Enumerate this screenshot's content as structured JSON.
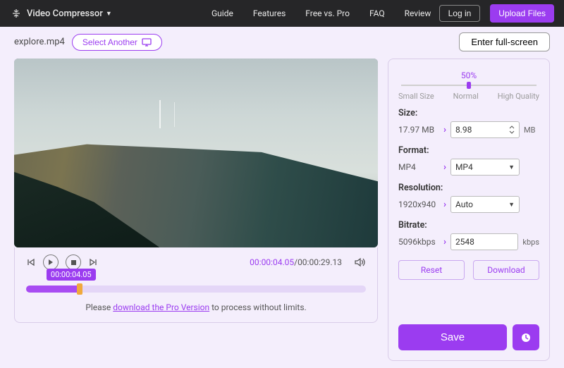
{
  "header": {
    "brand_icon": "compress-icon",
    "brand": "Video Compressor",
    "nav": [
      "Guide",
      "Features",
      "Free vs. Pro",
      "FAQ",
      "Review"
    ],
    "login": "Log in",
    "upload": "Upload Files"
  },
  "subheader": {
    "filename": "explore.mp4",
    "select_another": "Select Another",
    "fullscreen": "Enter full-screen"
  },
  "player": {
    "current_time": "00:00:04.05",
    "total_time": "00:00:29.13",
    "tooltip_time": "00:00:04.05",
    "progress_pct": 16
  },
  "limit": {
    "prefix": "Please ",
    "link": "download the Pro Version",
    "suffix": " to process without limits."
  },
  "settings": {
    "slider_value": "50%",
    "slider_labels": [
      "Small Size",
      "Normal",
      "High Quality"
    ],
    "size": {
      "label": "Size:",
      "current": "17.97 MB",
      "target": "8.98",
      "unit": "MB"
    },
    "format": {
      "label": "Format:",
      "current": "MP4",
      "target": "MP4"
    },
    "resolution": {
      "label": "Resolution:",
      "current": "1920x940",
      "target": "Auto"
    },
    "bitrate": {
      "label": "Bitrate:",
      "current": "5096kbps",
      "target": "2548",
      "unit": "kbps"
    },
    "reset": "Reset",
    "download": "Download",
    "save": "Save"
  }
}
